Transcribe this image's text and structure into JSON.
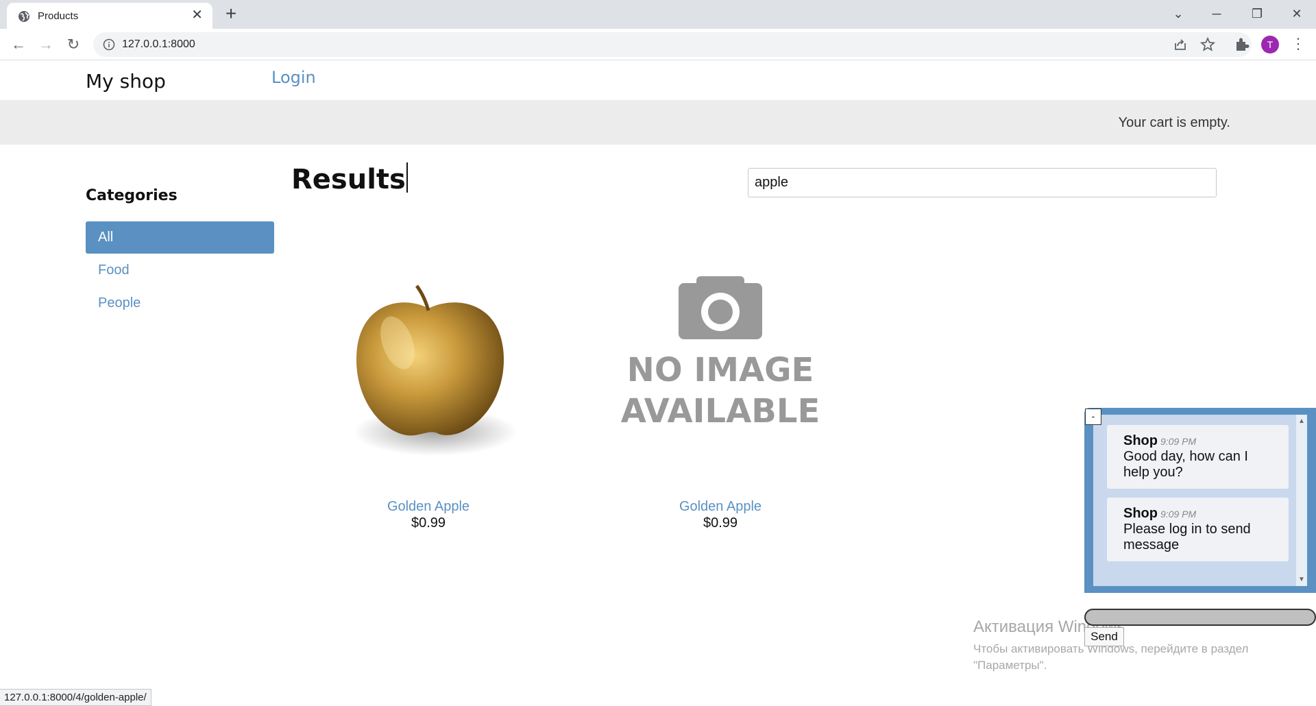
{
  "browser": {
    "tab_title": "Products",
    "url": "127.0.0.1:8000",
    "profile_initial": "T",
    "status_url": "127.0.0.1:8000/4/golden-apple/"
  },
  "header": {
    "brand": "My shop",
    "login": "Login"
  },
  "cart": {
    "text": "Your cart is empty."
  },
  "sidebar": {
    "title": "Categories",
    "items": [
      {
        "label": "All",
        "active": true
      },
      {
        "label": "Food",
        "active": false
      },
      {
        "label": "People",
        "active": false
      }
    ]
  },
  "main": {
    "title": "Results",
    "search_value": "apple",
    "products": [
      {
        "name": "Golden Apple",
        "price": "$0.99",
        "image": "golden-apple-photo"
      },
      {
        "name": "Golden Apple",
        "price": "$0.99",
        "image": "no-image-placeholder",
        "placeholder_line1": "NO IMAGE",
        "placeholder_line2": "AVAILABLE"
      }
    ]
  },
  "chat": {
    "minimize_label": "-",
    "messages": [
      {
        "author": "Shop",
        "time": "9:09 PM",
        "text": "Good day, how can I help you?"
      },
      {
        "author": "Shop",
        "time": "9:09 PM",
        "text": "Please log in to send message"
      }
    ],
    "send_label": "Send",
    "accent_color": "#5a91c2"
  },
  "os_overlay": {
    "title": "Активация Windows",
    "subtitle_line1": "Чтобы активировать Windows, перейдите в раздел",
    "subtitle_line2": "\"Параметры\"."
  }
}
